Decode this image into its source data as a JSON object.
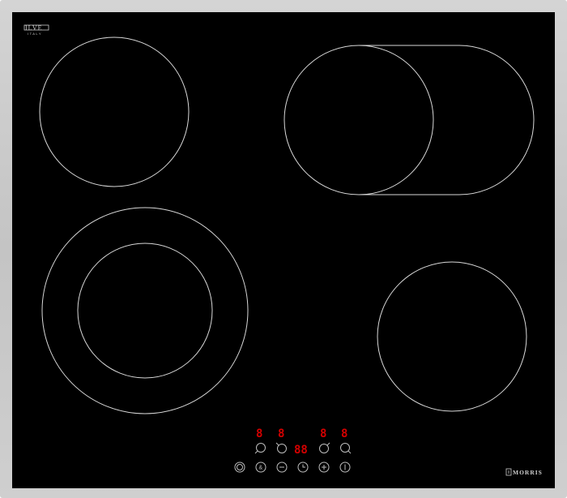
{
  "hob": {
    "frame_color": "#c8c8c8",
    "glass_color": "#000000",
    "zone_line_color": "#d8d8d8",
    "display_color": "#d40000"
  },
  "logo": {
    "mark": "ILVE",
    "subtitle": "ITALY"
  },
  "brand": {
    "name": "MORRIS",
    "icon": "morris-emblem-icon"
  },
  "displays": {
    "zone_front_left": "8",
    "zone_rear_left": "8",
    "timer": "88",
    "zone_rear_right": "8",
    "zone_front_right": "8"
  },
  "zone_selectors": [
    {
      "icon": "zone-front-left-icon"
    },
    {
      "icon": "zone-rear-left-icon"
    },
    {
      "icon": "zone-rear-right-icon"
    },
    {
      "icon": "zone-front-right-icon"
    }
  ],
  "controls": [
    {
      "icon": "dual-zone-icon"
    },
    {
      "icon": "lock-icon",
      "label": "&"
    },
    {
      "icon": "minus-icon"
    },
    {
      "icon": "timer-icon"
    },
    {
      "icon": "plus-icon"
    },
    {
      "icon": "power-icon"
    }
  ]
}
